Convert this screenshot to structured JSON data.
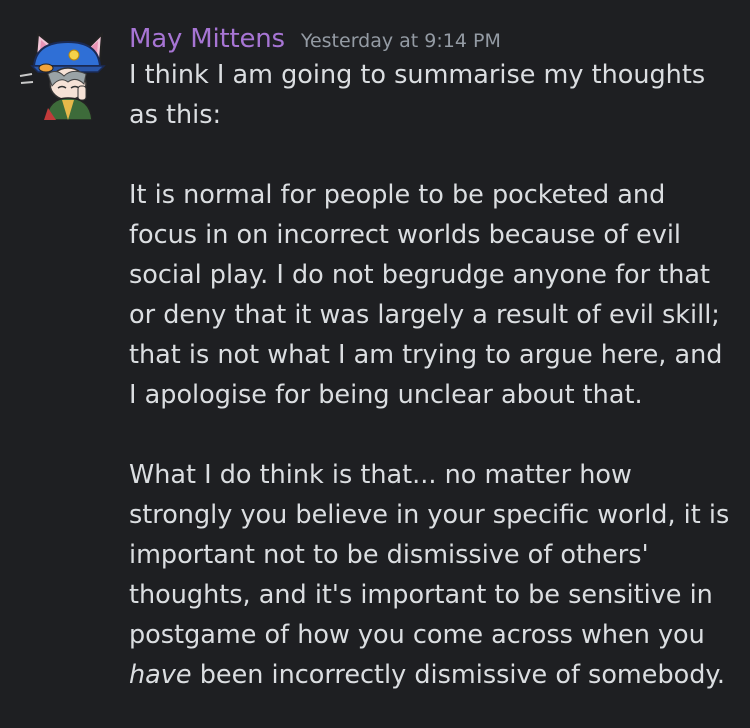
{
  "message": {
    "author": "May Mittens",
    "timestamp": "Yesterday at 9:14 PM",
    "paragraphs": [
      "I think I am going to summarise my thoughts as this:",
      "It is normal for people to be pocketed and focus in on incorrect worlds because of evil social play. I do not begrudge anyone for that or deny that it was largely a result of evil skill; that is not what I am trying to argue here, and I apologise for being unclear about that.",
      "What I do think is that... no matter how strongly you believe in your specific world, it is important not to be dismissive of others' thoughts, and it's important to be sensitive in postgame of how you come across when you"
    ],
    "final_emphasis": "have",
    "final_tail": "been incorrectly dismissive of somebody."
  },
  "colors": {
    "background": "#1e1f22",
    "username": "#a775d4",
    "timestamp": "#949ba4",
    "text": "#dbdee1",
    "avatar_hat": "#2f6fd6",
    "avatar_ears": "#f2c6d8"
  },
  "icons": {
    "avatar": "cat-ear-girl-avatar"
  }
}
